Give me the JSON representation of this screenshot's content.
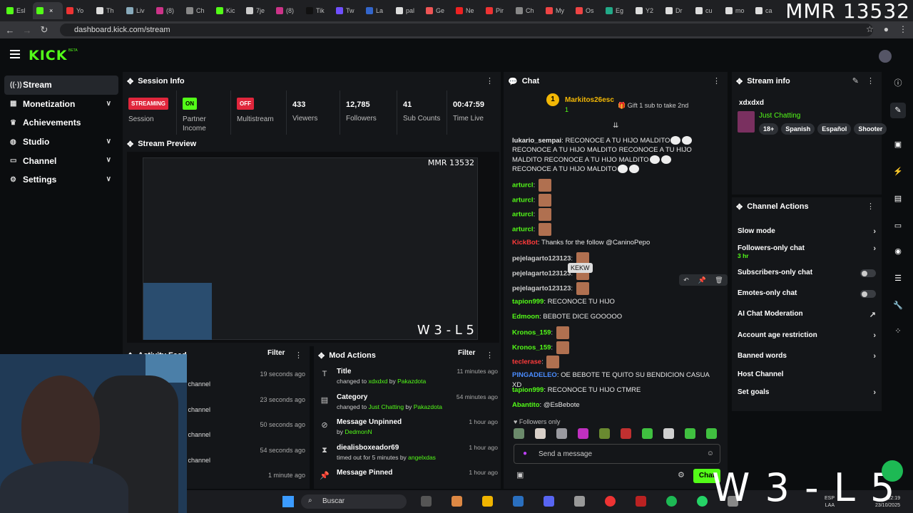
{
  "browser": {
    "tabs": [
      "Esl",
      "",
      "Yo",
      "Th",
      "Liv",
      "(8)",
      "Ch",
      "Kic",
      "7je",
      "(8)",
      "Tik",
      "Tw",
      "La",
      "pal",
      "Ge",
      "Ne",
      "Pir",
      "Ch",
      "My",
      "Os",
      "Eg",
      "Y2",
      "Dr",
      "cu",
      "mo",
      "ca"
    ],
    "overlay_mmr": "MMR 13532",
    "url": "dashboard.kick.com/stream"
  },
  "kick": {
    "logo": "KICK",
    "beta": "BETA"
  },
  "sidebar": {
    "items": [
      {
        "label": "Stream"
      },
      {
        "label": "Monetization"
      },
      {
        "label": "Achievements"
      },
      {
        "label": "Studio"
      },
      {
        "label": "Channel"
      },
      {
        "label": "Settings"
      }
    ]
  },
  "session": {
    "title": "Session Info",
    "stats": [
      {
        "badge": "STREAMING",
        "label": "Session"
      },
      {
        "badge": "ON",
        "label": "Partner Income"
      },
      {
        "badge": "OFF",
        "label": "Multistream"
      },
      {
        "value": "433",
        "label": "Viewers"
      },
      {
        "value": "12,785",
        "label": "Followers"
      },
      {
        "value": "41",
        "label": "Sub Counts"
      },
      {
        "value": "00:47:59",
        "label": "Time Live"
      }
    ]
  },
  "preview": {
    "title": "Stream Preview",
    "mmr": "MMR 13532",
    "wl": "W 3 - L 5"
  },
  "activity": {
    "title": "Activity Feed",
    "filter": "Filter",
    "rows": [
      {
        "time": "19 seconds ago",
        "text": "e channel"
      },
      {
        "time": "23 seconds ago",
        "text": "e channel"
      },
      {
        "time": "50 seconds ago",
        "text": "e channel"
      },
      {
        "time": "54 seconds ago",
        "text": "e channel"
      },
      {
        "time": "1 minute ago",
        "text": ""
      }
    ]
  },
  "mod_actions": {
    "title": "Mod Actions",
    "filter": "Filter",
    "rows": [
      {
        "icon": "T",
        "title": "Title",
        "pre": "changed to ",
        "a": "xdxdxd",
        "mid": " by ",
        "b": "Pakazdota",
        "time": "11 minutes ago"
      },
      {
        "icon": "▤",
        "title": "Category",
        "pre": "changed to ",
        "a": "Just Chatting",
        "mid": " by ",
        "b": "Pakazdota",
        "time": "54 minutes ago"
      },
      {
        "icon": "⊘",
        "title": "Message Unpinned",
        "pre": "by ",
        "a": "DedmonN",
        "mid": "",
        "b": "",
        "time": "1 hour ago"
      },
      {
        "icon": "⧗",
        "title": "diealisboxeador69",
        "pre": "timed out for 5 minutes by ",
        "a": "angelxdas",
        "mid": "",
        "b": "",
        "time": "1 hour ago"
      },
      {
        "icon": "📌",
        "title": "Message Pinned",
        "pre": "",
        "a": "",
        "mid": "",
        "b": "",
        "time": "1 hour ago"
      }
    ]
  },
  "chat": {
    "title": "Chat",
    "pinned_user": "Markitos26esc",
    "pinned_count": "1",
    "gift_text": "Gift 1 sub to take 2nd",
    "messages": [
      {
        "user": "lukario_sempai",
        "color": "#e8e8e8",
        "text": "RECONOCE A TU HIJO MALDITO"
      },
      {
        "user": "",
        "color": "#e8e8e8",
        "text": "RECONOCE A TU HIJO MALDITO RECONOCE A TU HIJO MALDITO RECONOCE A TU HIJO MALDITO"
      },
      {
        "user": "",
        "color": "#e8e8e8",
        "text": "RECONOCE A TU HIJO MALDITO"
      },
      {
        "user": "arturcl",
        "color": "#53fc18",
        "text": ""
      },
      {
        "user": "arturcl",
        "color": "#53fc18",
        "text": ""
      },
      {
        "user": "arturcl",
        "color": "#53fc18",
        "text": ""
      },
      {
        "user": "arturcl",
        "color": "#53fc18",
        "text": ""
      },
      {
        "user": "KickBot",
        "color": "#ff3b3b",
        "text": "Thanks for the follow @CaninoPepo"
      },
      {
        "user": "pejelagarto123123",
        "color": "#d0d0d0",
        "text": ""
      },
      {
        "user": "pejelagarto123123",
        "color": "#d0d0d0",
        "text": ""
      },
      {
        "user": "pejelagarto123123",
        "color": "#d0d0d0",
        "text": ""
      },
      {
        "user": "tapion999",
        "color": "#53fc18",
        "text": "RECONOCE TU HIJO"
      },
      {
        "user": "Edmoon",
        "color": "#53fc18",
        "text": "BEBOTE DICE GOOOOO"
      },
      {
        "user": "Kronos_159",
        "color": "#53fc18",
        "text": ""
      },
      {
        "user": "Kronos_159",
        "color": "#53fc18",
        "text": ""
      },
      {
        "user": "teclerase",
        "color": "#ff3b3b",
        "text": ""
      },
      {
        "user": "PINGADELEO",
        "color": "#4a8cff",
        "text": "OE BEBOTE TE QUITO SU BENDICION CASUA XD"
      },
      {
        "user": "tapion999",
        "color": "#53fc18",
        "text": "RECONOCE TU HIJO CTMRE"
      },
      {
        "user": "Abantito",
        "color": "#53fc18",
        "text": "@EsBebote"
      }
    ],
    "tooltip": "KEKW",
    "followers_only": "Followers only",
    "emote_colors": [
      "#6b8a6b",
      "#d8d0c8",
      "#9a9aa0",
      "#c030c0",
      "#6a8a30",
      "#c03030",
      "#40c040",
      "#d0d0d0",
      "#40c040",
      "#40c040"
    ],
    "input_placeholder": "Send a message",
    "send_label": "Chat"
  },
  "stream_info": {
    "title": "Stream info",
    "stream_title": "xdxdxd",
    "category": "Just Chatting",
    "tags": [
      "18+",
      "Spanish",
      "Español",
      "Shooter"
    ]
  },
  "channel_actions": {
    "title": "Channel Actions",
    "items": [
      {
        "label": "Slow mode",
        "control": "chevron"
      },
      {
        "label": "Followers-only chat",
        "sub": "3 hr",
        "control": "chevron"
      },
      {
        "label": "Subscribers-only chat",
        "control": "toggle"
      },
      {
        "label": "Emotes-only chat",
        "control": "toggle"
      },
      {
        "label": "AI Chat Moderation",
        "control": "external"
      },
      {
        "label": "Account age restriction",
        "control": "chevron"
      },
      {
        "label": "Banned words",
        "control": "chevron"
      },
      {
        "label": "Host Channel",
        "control": "none"
      },
      {
        "label": "Set goals",
        "control": "chevron"
      }
    ]
  },
  "taskbar": {
    "search": "Buscar",
    "lang": "ESP",
    "lang2": "LAA",
    "time": "22:19",
    "date": "23/10/2025"
  },
  "overlay_wl": "W 3 - L 5"
}
